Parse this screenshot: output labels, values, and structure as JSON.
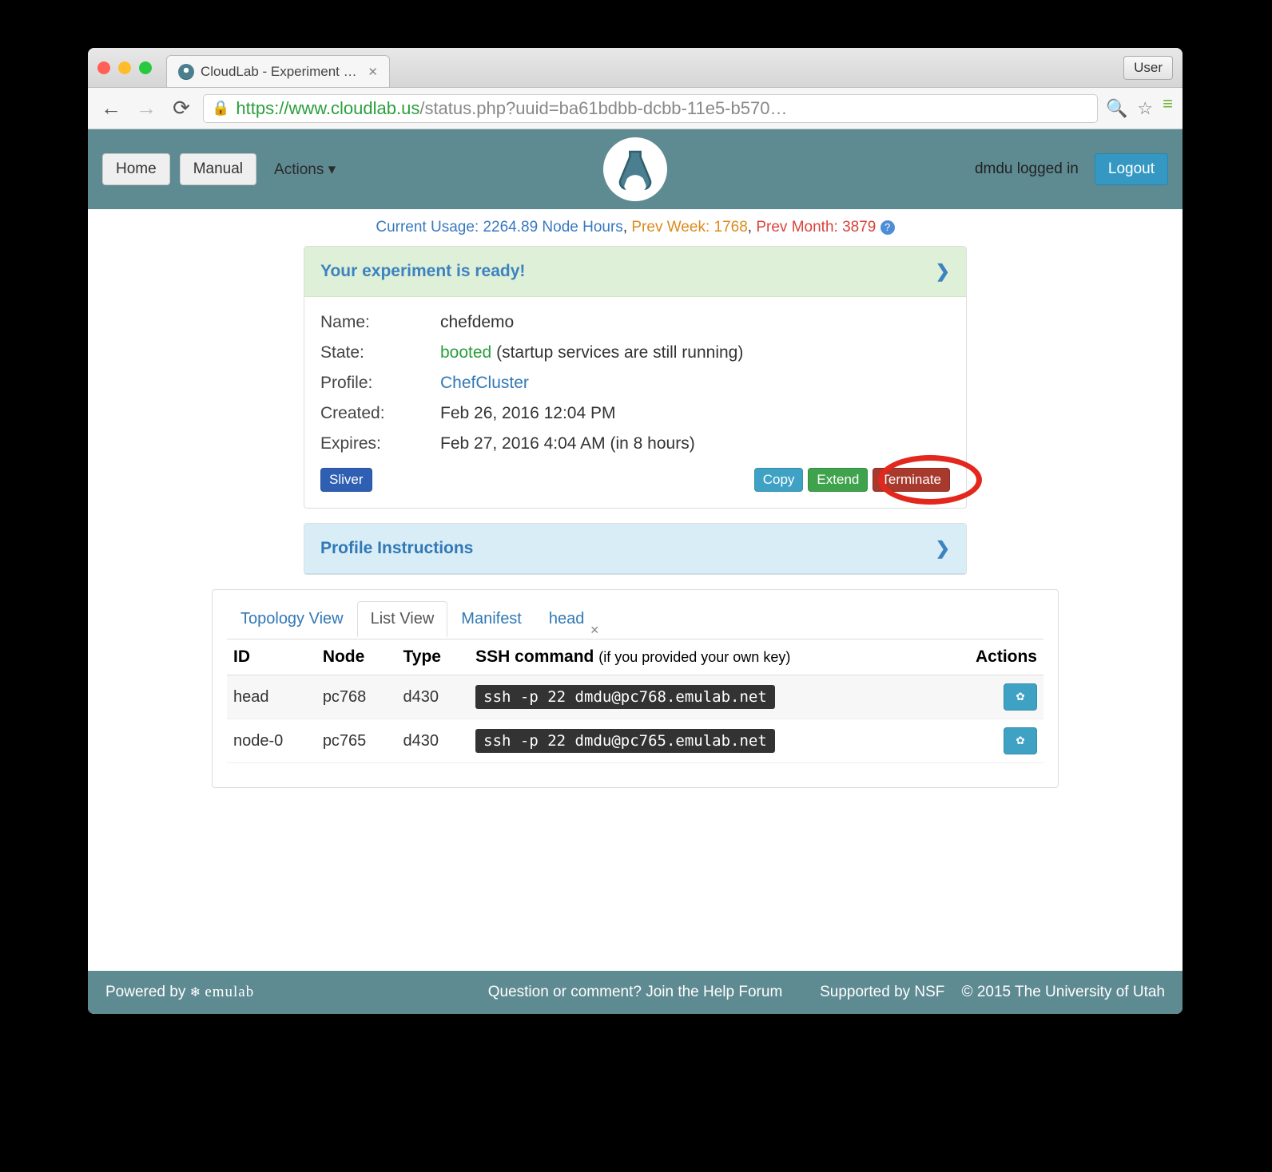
{
  "browser": {
    "tab_title": "CloudLab - Experiment Sta",
    "user_button": "User",
    "url_scheme": "https",
    "url_host": "://www.cloudlab.us",
    "url_path": "/status.php?uuid=ba61bdbb-dcbb-11e5-b570…"
  },
  "topbar": {
    "home": "Home",
    "manual": "Manual",
    "actions": "Actions",
    "logged_in": "dmdu logged in",
    "logout": "Logout"
  },
  "usage": {
    "prefix": "Current Usage: ",
    "current": "2264.89 Node Hours",
    "prev_week_label": "Prev Week: ",
    "prev_week": "1768",
    "prev_month_label": "Prev Month: ",
    "prev_month": "3879"
  },
  "status_panel": {
    "title": "Your experiment is ready!",
    "name_label": "Name:",
    "name": "chefdemo",
    "state_label": "State:",
    "state": "booted",
    "state_note": "(startup services are still running)",
    "profile_label": "Profile:",
    "profile": "ChefCluster",
    "created_label": "Created:",
    "created": "Feb 26, 2016 12:04 PM",
    "expires_label": "Expires:",
    "expires": "Feb 27, 2016 4:04 AM (in 8 hours)",
    "buttons": {
      "sliver": "Sliver",
      "copy": "Copy",
      "extend": "Extend",
      "terminate": "Terminate"
    }
  },
  "instructions_panel": {
    "title": "Profile Instructions"
  },
  "tabs": {
    "topology": "Topology View",
    "list": "List View",
    "manifest": "Manifest",
    "head": "head"
  },
  "list_table": {
    "headers": {
      "id": "ID",
      "node": "Node",
      "type": "Type",
      "ssh": "SSH command",
      "ssh_note": "(if you provided your own key)",
      "actions": "Actions"
    },
    "rows": [
      {
        "id": "head",
        "node": "pc768",
        "type": "d430",
        "ssh": "ssh -p 22 dmdu@pc768.emulab.net"
      },
      {
        "id": "node-0",
        "node": "pc765",
        "type": "d430",
        "ssh": "ssh -p 22 dmdu@pc765.emulab.net"
      }
    ]
  },
  "footer": {
    "powered": "Powered by ",
    "emulab": "emulab",
    "center": "Question or comment? Join the Help Forum",
    "nsf": "Supported by NSF",
    "copyright": "© 2015 The University of Utah"
  }
}
